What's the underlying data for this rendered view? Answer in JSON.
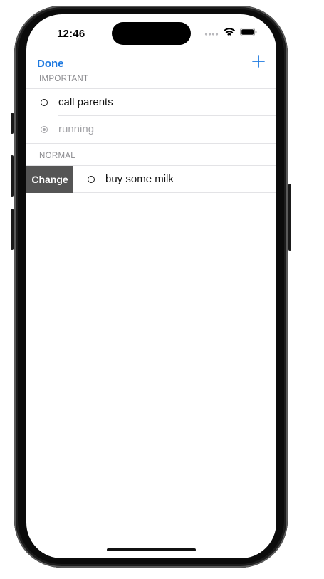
{
  "status_bar": {
    "time": "12:46",
    "icons": [
      "signal-dots-icon",
      "wifi-icon",
      "battery-icon"
    ]
  },
  "nav": {
    "done_label": "Done",
    "add_icon": "plus-icon"
  },
  "sections": [
    {
      "header": "IMPORTANT",
      "items": [
        {
          "label": "call parents",
          "completed": false
        },
        {
          "label": "running",
          "completed": true
        }
      ]
    },
    {
      "header": "NORMAL",
      "items": [
        {
          "label": "buy some milk",
          "completed": false,
          "swipe_action": "Change"
        }
      ]
    }
  ],
  "colors": {
    "accent": "#1f7ae0",
    "swipe_action_bg": "#555555",
    "completed_text": "#a1a1a5"
  }
}
